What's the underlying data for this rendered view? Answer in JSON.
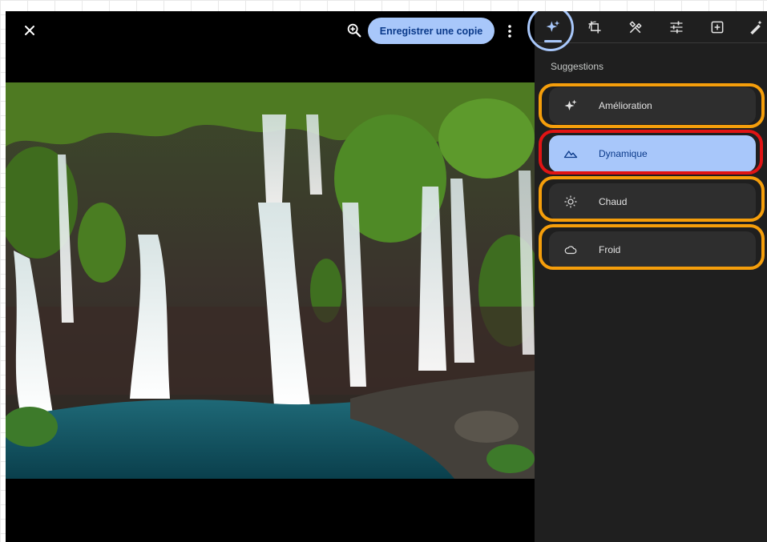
{
  "toolbar": {
    "save_label": "Enregistrer une copie"
  },
  "panel": {
    "section_title": "Suggestions",
    "tabs": [
      {
        "icon": "sparkle-icon",
        "active": true
      },
      {
        "icon": "crop-rotate-icon"
      },
      {
        "icon": "tools-icon"
      },
      {
        "icon": "adjust-sliders-icon"
      },
      {
        "icon": "add-frame-icon"
      },
      {
        "icon": "markup-icon"
      }
    ],
    "suggestions": [
      {
        "label": "Amélioration",
        "icon": "enhance-sparkle-icon"
      },
      {
        "label": "Dynamique",
        "icon": "mountain-icon",
        "selected": true
      },
      {
        "label": "Chaud",
        "icon": "sun-icon"
      },
      {
        "label": "Froid",
        "icon": "cloud-icon"
      }
    ]
  },
  "colors": {
    "accent": "#a8c7fa",
    "highlight_orange": "#f59e0b",
    "highlight_red": "#e11414",
    "panel_bg": "#1f1f1f"
  }
}
